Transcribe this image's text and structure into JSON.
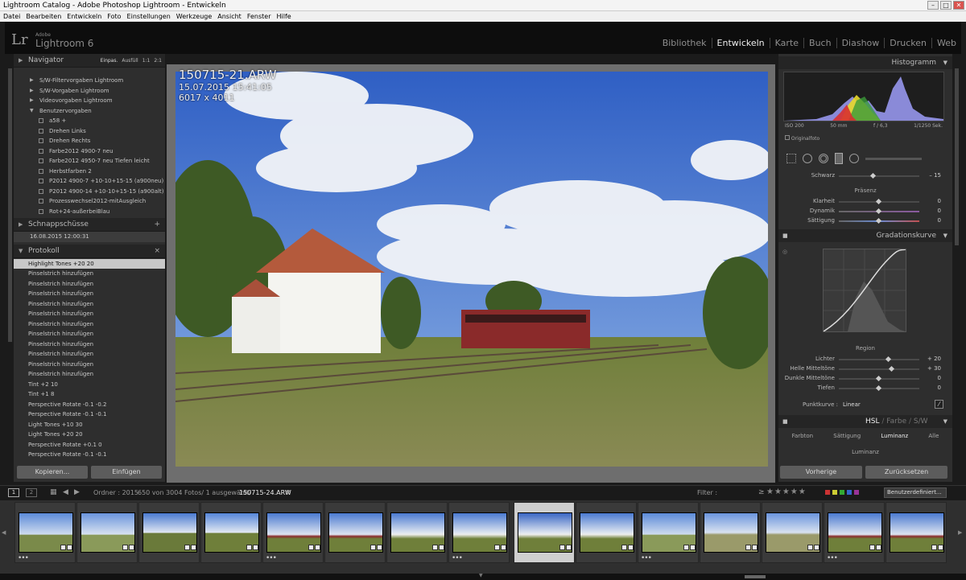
{
  "window": {
    "title": "Lightroom Catalog - Adobe Photoshop Lightroom - Entwickeln",
    "btn_min": "–",
    "btn_max": "□",
    "btn_close": "✕"
  },
  "menu": [
    "Datei",
    "Bearbeiten",
    "Entwickeln",
    "Foto",
    "Einstellungen",
    "Werkzeuge",
    "Ansicht",
    "Fenster",
    "Hilfe"
  ],
  "header": {
    "logo": "Lr",
    "adobe": "Adobe",
    "product": "Lightroom 6",
    "modules": [
      "Bibliothek",
      "Entwickeln",
      "Karte",
      "Buch",
      "Diashow",
      "Drucken",
      "Web"
    ],
    "active_module": "Entwickeln"
  },
  "navigator": {
    "title": "Navigator",
    "zoom": [
      "Einpas.",
      "Ausfüll",
      "1:1",
      "2:1"
    ]
  },
  "presets": {
    "groups": [
      "S/W-Filtervorgaben Lightroom",
      "S/W-Vorgaben Lightroom",
      "Videovorgaben Lightroom",
      "Benutzervorgaben"
    ],
    "items": [
      "a58 +",
      "Drehen Links",
      "Drehen Rechts",
      "Farbe2012 4900-7 neu",
      "Farbe2012 4950-7 neu Tiefen leicht",
      "Herbstfarben 2",
      "P2012 4900-7 +10-10+15-15 (a900neu)",
      "P2012 4900-14 +10-10+15-15 (a900alt)",
      "Prozesswechsel2012-mitAusgleich",
      "Rot+24-außerbeiBlau"
    ]
  },
  "snapshots": {
    "title": "Schnappschüsse",
    "add": "+",
    "items": [
      "16.08.2015 12:00:31"
    ]
  },
  "history": {
    "title": "Protokoll",
    "close": "×",
    "items": [
      "Highlight Tones  +20  20",
      "Pinselstrich hinzufügen",
      "Pinselstrich hinzufügen",
      "Pinselstrich hinzufügen",
      "Pinselstrich hinzufügen",
      "Pinselstrich hinzufügen",
      "Pinselstrich hinzufügen",
      "Pinselstrich hinzufügen",
      "Pinselstrich hinzufügen",
      "Pinselstrich hinzufügen",
      "Pinselstrich hinzufügen",
      "Pinselstrich hinzufügen",
      "Tint  +2  10",
      "Tint  +1  8",
      "Perspective Rotate  -0.1  -0.2",
      "Perspective Rotate  -0.1  -0.1",
      "Light Tones  +10  30",
      "Light Tones  +20  20",
      "Perspective Rotate  +0.1  0",
      "Perspective Rotate  -0.1  -0.1"
    ]
  },
  "left_buttons": {
    "copy": "Kopieren...",
    "paste": "Einfügen"
  },
  "photo": {
    "title": "150715-21.ARW",
    "date": "15.07.2015 15:41:05",
    "dims": "6017 x 4011"
  },
  "histogram": {
    "title": "Histogramm",
    "iso": "ISO 200",
    "focal": "50 mm",
    "aperture": "f / 6,3",
    "shutter": "1/1250 Sek.",
    "original": "Originalfoto"
  },
  "basic": {
    "schwarz_label": "Schwarz",
    "schwarz_val": "– 15",
    "presence": "Präsenz",
    "klarheit": "Klarheit",
    "klarheit_val": "0",
    "dynamik": "Dynamik",
    "dynamik_val": "0",
    "saettigung": "Sättigung",
    "saettigung_val": "0"
  },
  "tonecurve": {
    "title": "Gradationskurve",
    "region": "Region",
    "lichter": "Lichter",
    "lichter_val": "+ 20",
    "helle": "Helle Mitteltöne",
    "helle_val": "+ 30",
    "dunkle": "Dunkle Mitteltöne",
    "dunkle_val": "0",
    "tiefen": "Tiefen",
    "tiefen_val": "0",
    "punktkurve": "Punktkurve :",
    "punktkurve_val": "Linear"
  },
  "hsl": {
    "title": "HSL",
    "sep1": "/",
    "farbe": "Farbe",
    "sep2": "/",
    "sw": "S/W",
    "tabs": [
      "Farbton",
      "Sättigung",
      "Luminanz",
      "Alle"
    ],
    "luminanz": "Luminanz"
  },
  "right_buttons": {
    "prev": "Vorherige",
    "reset": "Zurücksetzen"
  },
  "filmbar": {
    "screen1": "1",
    "screen2": "2",
    "ordner": "Ordner : 2015",
    "count": "650 von 3004 Fotos/ 1 ausgewählt/",
    "file": "150715-24.ARW",
    "filter": "Filter :",
    "ge": "≥",
    "stars": "★★★★★",
    "custom": "Benutzerdefiniert..."
  },
  "colors": {
    "accent": "#c8c8c8",
    "panel": "#2e2e2e",
    "sky": "#3a66c4"
  }
}
